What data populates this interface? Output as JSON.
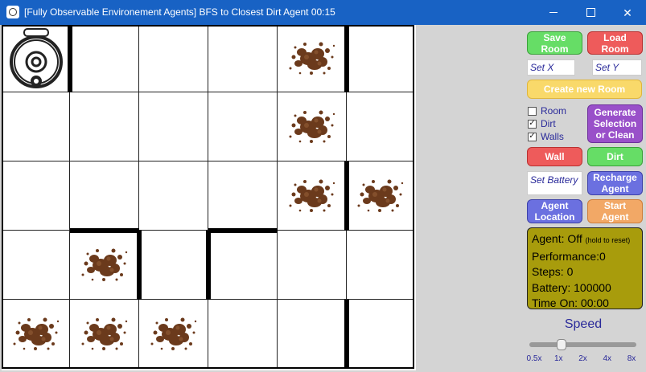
{
  "window": {
    "title": "[Fully Observable Environement Agents] BFS to Closest Dirt Agent 00:15",
    "controls": {
      "minimize": "minimize",
      "maximize": "maximize",
      "close": "✕"
    }
  },
  "grid": {
    "rows": 5,
    "cols": 6,
    "agent": {
      "row": 0,
      "col": 0
    },
    "dirt_cells": [
      {
        "row": 0,
        "col": 4
      },
      {
        "row": 1,
        "col": 4
      },
      {
        "row": 2,
        "col": 4
      },
      {
        "row": 2,
        "col": 5
      },
      {
        "row": 3,
        "col": 1
      },
      {
        "row": 4,
        "col": 0
      },
      {
        "row": 4,
        "col": 1
      },
      {
        "row": 4,
        "col": 2
      }
    ],
    "walls": [
      {
        "type": "vertical",
        "row": 0,
        "after_col": 0
      },
      {
        "type": "vertical",
        "row": 0,
        "after_col": 4
      },
      {
        "type": "vertical",
        "row": 2,
        "after_col": 4
      },
      {
        "type": "vertical",
        "row": 3,
        "after_col": 1
      },
      {
        "type": "vertical",
        "row": 3,
        "after_col": 2
      },
      {
        "type": "vertical",
        "row": 4,
        "after_col": 4
      },
      {
        "type": "horizontal",
        "above_row": 3,
        "col": 1
      },
      {
        "type": "horizontal",
        "above_row": 3,
        "col": 3
      }
    ]
  },
  "panel": {
    "save_room": "Save\nRoom",
    "load_room": "Load\nRoom",
    "set_x_placeholder": "Set X",
    "set_y_placeholder": "Set Y",
    "create_room": "Create new Room",
    "checkboxes": [
      {
        "label": "Room",
        "checked": false
      },
      {
        "label": "Dirt",
        "checked": true
      },
      {
        "label": "Walls",
        "checked": true
      }
    ],
    "generate": "Generate\nSelection\nor Clean",
    "wall": "Wall",
    "dirt": "Dirt",
    "set_battery_placeholder": "Set Battery",
    "recharge": "Recharge\nAgent",
    "agent_location": "Agent\nLocation",
    "start_agent": "Start\nAgent",
    "status": {
      "agent_label": "Agent: Off",
      "agent_hint": "(hold to reset)",
      "performance": "Performance:0",
      "steps": "Steps: 0",
      "battery": "Battery: 100000",
      "time_on": "Time On: 00:00"
    },
    "speed": {
      "label": "Speed",
      "ticks": [
        "0.5x",
        "1x",
        "2x",
        "4x",
        "8x"
      ],
      "value_index": 1
    }
  },
  "colors": {
    "titlebar": "#1862c4",
    "dirt": "#6b3a1c",
    "status_bg": "#a89c0c"
  }
}
